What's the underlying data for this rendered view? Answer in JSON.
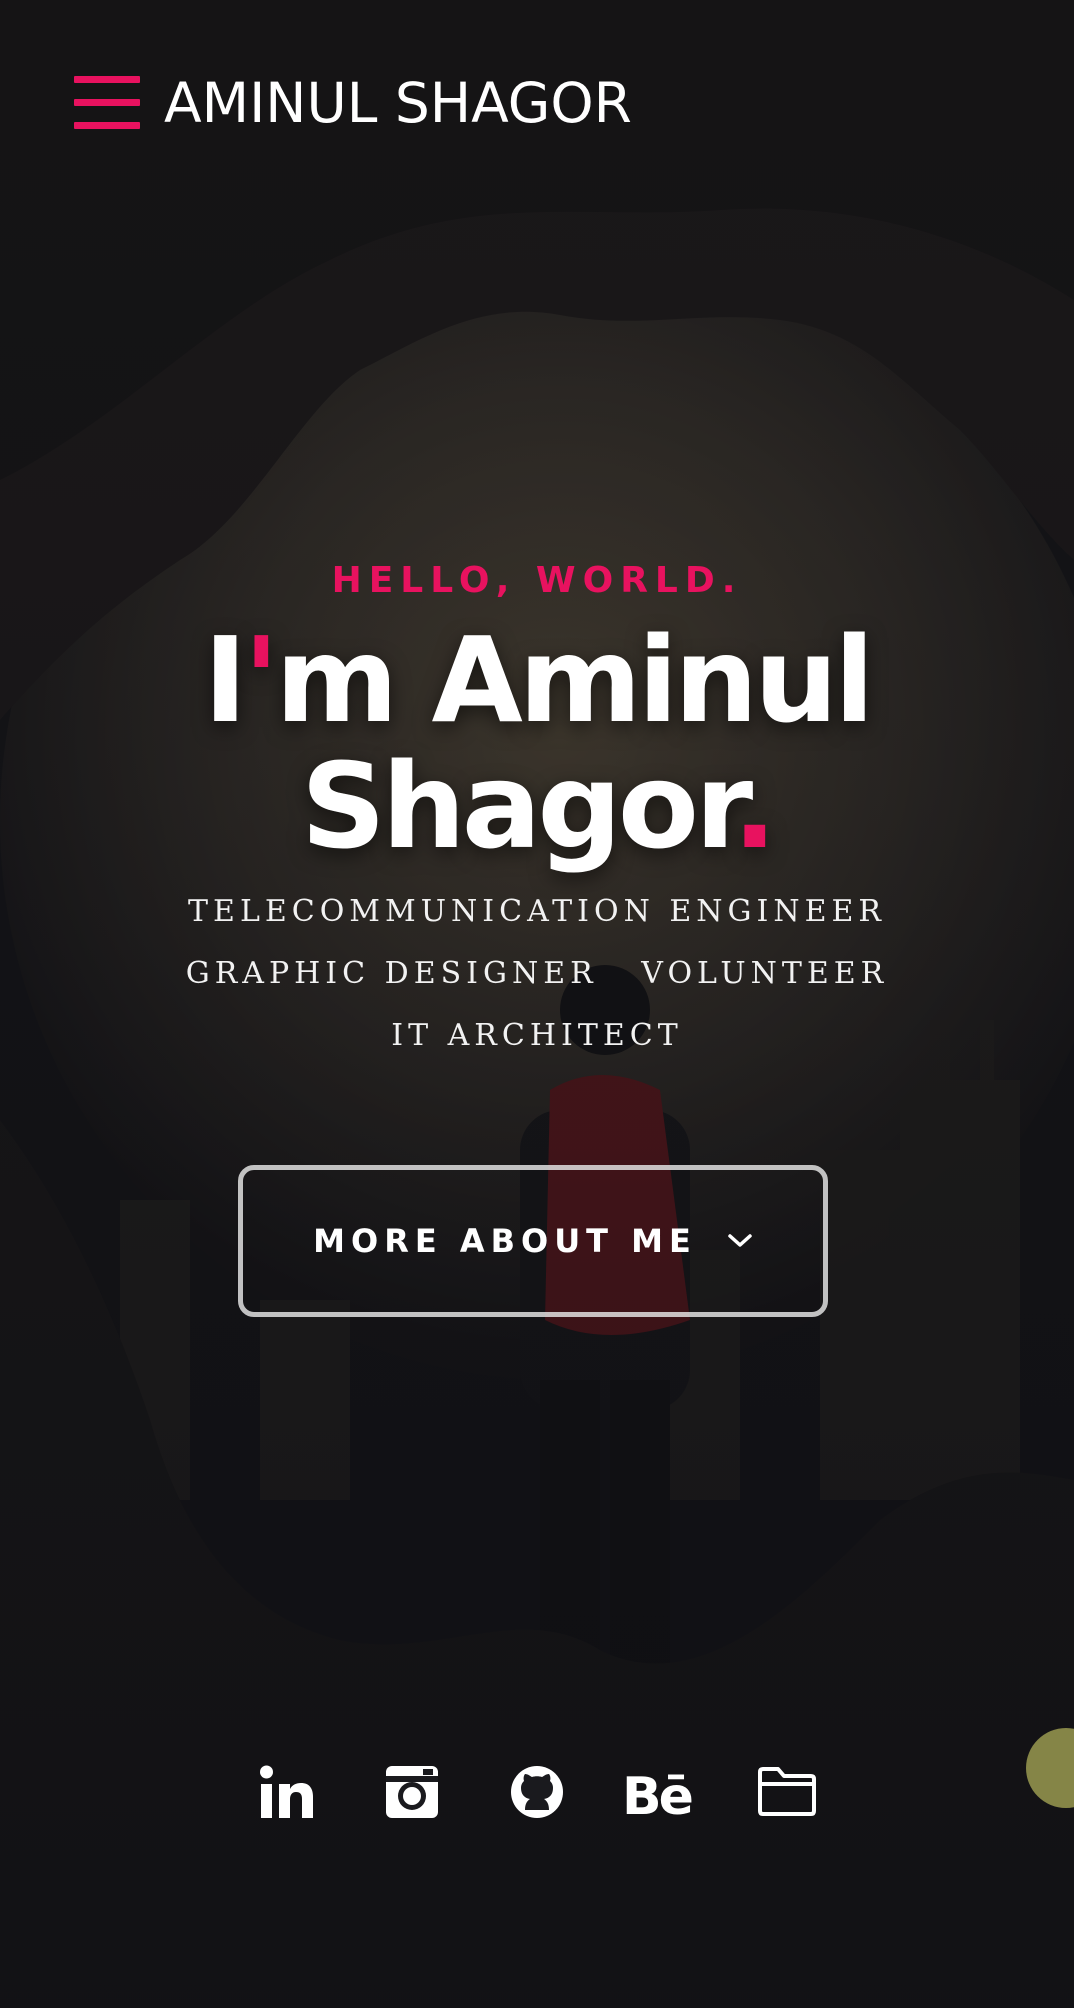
{
  "header": {
    "brand": "AMINUL SHAGOR",
    "menu_icon": "hamburger-menu-icon"
  },
  "hero": {
    "greeting": "HELLO, WORLD.",
    "name_prefix": "I",
    "apostrophe": "'",
    "name_line1_rest": "m Aminul",
    "name_line2": "Shagor",
    "name_dot": ".",
    "roles": [
      "TELECOMMUNICATION ENGINEER",
      "GRAPHIC DESIGNER   VOLUNTEER",
      "IT ARCHITECT"
    ]
  },
  "cta": {
    "label": "MORE ABOUT ME",
    "icon": "chevron-down-icon"
  },
  "socials": [
    {
      "name": "linkedin-icon"
    },
    {
      "name": "instagram-icon"
    },
    {
      "name": "github-icon"
    },
    {
      "name": "behance-icon",
      "glyph": "Bē"
    },
    {
      "name": "folder-icon"
    }
  ],
  "colors": {
    "accent": "#e8125f",
    "text": "#ffffff",
    "background": "#15151a"
  }
}
